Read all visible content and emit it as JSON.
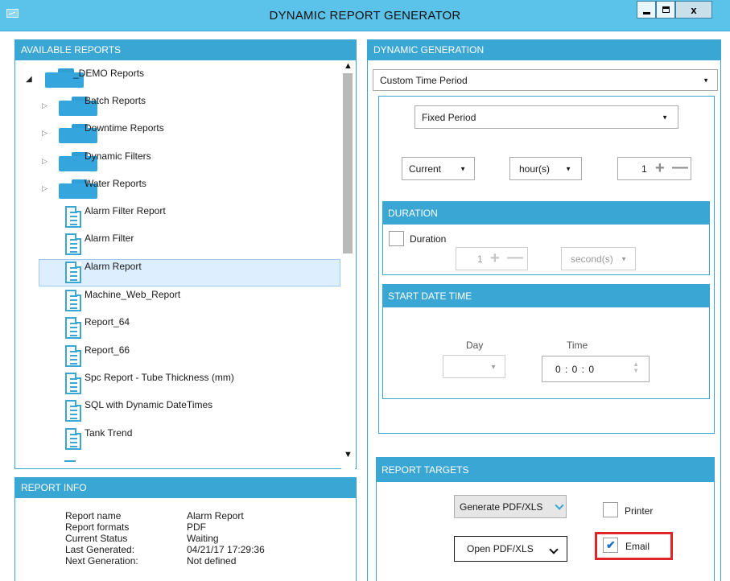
{
  "window": {
    "title": "DYNAMIC REPORT GENERATOR",
    "controls": {
      "minimize": "_",
      "maximize": "□",
      "close": "x"
    }
  },
  "available_reports": {
    "header": "AVAILABLE REPORTS",
    "root": {
      "label": "_DEMO Reports",
      "expanded": true
    },
    "items": [
      {
        "type": "folder",
        "label": "Batch Reports"
      },
      {
        "type": "folder",
        "label": "Downtime Reports"
      },
      {
        "type": "folder",
        "label": "Dynamic Filters"
      },
      {
        "type": "folder",
        "label": "Water Reports"
      },
      {
        "type": "report",
        "label": "Alarm Filter Report"
      },
      {
        "type": "report",
        "label": "Alarm Filter"
      },
      {
        "type": "report",
        "label": "Alarm Report",
        "selected": true
      },
      {
        "type": "report",
        "label": "Machine_Web_Report"
      },
      {
        "type": "report",
        "label": "Report_64"
      },
      {
        "type": "report",
        "label": "Report_66"
      },
      {
        "type": "report",
        "label": "Spc Report - Tube Thickness (mm)"
      },
      {
        "type": "report",
        "label": "SQL with Dynamic DateTimes"
      },
      {
        "type": "report",
        "label": "Tank Trend"
      }
    ]
  },
  "report_info": {
    "header": "REPORT INFO",
    "rows": [
      {
        "key": "Report name",
        "value": "Alarm Report"
      },
      {
        "key": "Report formats",
        "value": "PDF"
      },
      {
        "key": "Current Status",
        "value": "Waiting"
      },
      {
        "key": "Last Generated:",
        "value": "04/21/17 17:29:36"
      },
      {
        "key": "Next Generation:",
        "value": "Not defined"
      }
    ]
  },
  "dynamic_generation": {
    "header": "DYNAMIC GENERATION",
    "time_mode": "Custom Time Period",
    "period_type": "Fixed Period",
    "relative": "Current",
    "unit": "hour(s)",
    "count": "1",
    "duration": {
      "header": "DURATION",
      "checkbox_label": "Duration",
      "checked": false,
      "count": "1",
      "unit": "second(s)"
    },
    "start_date_time": {
      "header": "START DATE TIME",
      "day_label": "Day",
      "day_value": "",
      "time_label": "Time",
      "time_value": "0 : 0 : 0"
    }
  },
  "report_targets": {
    "header": "REPORT TARGETS",
    "generate_label": "Generate PDF/XLS",
    "open_label": "Open PDF/XLS",
    "printer_label": "Printer",
    "printer_checked": false,
    "email_label": "Email",
    "email_checked": true
  },
  "colors": {
    "accent": "#3aa6d4",
    "titlebar": "#5bc2ea",
    "selection": "#ddeeff",
    "highlight": "#e0252a"
  }
}
